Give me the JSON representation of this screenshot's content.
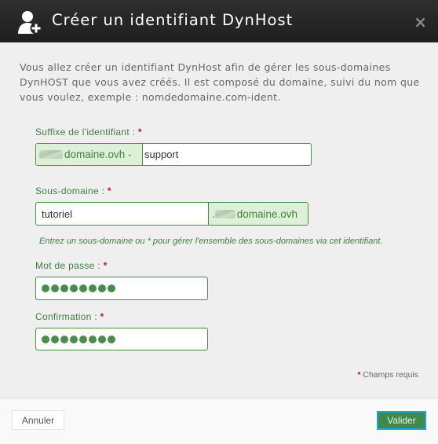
{
  "dialog": {
    "title": "Créer un identifiant DynHost",
    "close_symbol": "×",
    "icon": "add-user-icon"
  },
  "intro": "Vous allez créer un identifiant DynHost afin de gérer les sous-domaines DynHOST que vous avez créés. Il est composé du domaine, suivi du nom que vous voulez, exemple : nomdedomaine.com-ident.",
  "form": {
    "required_marker": "*",
    "suffix": {
      "label": "Suffixe de l'identifiant :",
      "prefix_addon": "domaine.ovh -",
      "value": "support"
    },
    "subdomain": {
      "label": "Sous-domaine :",
      "value": "tutoriel",
      "suffix_addon": ".",
      "suffix_domain": "domaine.ovh",
      "help": "Entrez un sous-domaine ou * pour gérer l'ensemble des sous-domaines via cet identifiant."
    },
    "password": {
      "label": "Mot de passe :",
      "masked_length": 8
    },
    "confirmation": {
      "label": "Confirmation :",
      "masked_length": 8
    },
    "required_note": "Champs requis"
  },
  "footer": {
    "cancel_label": "Annuler",
    "validate_label": "Valider"
  },
  "colors": {
    "header_bg": "#262626",
    "accent_green": "#4b8b4b",
    "addon_bg": "#dff0d8",
    "required_red": "#c8102e",
    "focus_blue": "#1aa3e8"
  }
}
